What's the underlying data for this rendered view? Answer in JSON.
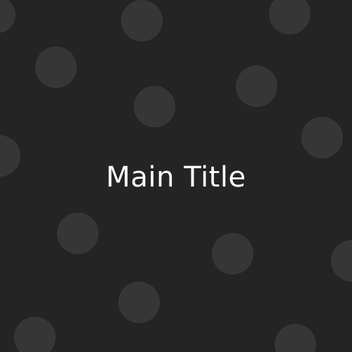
{
  "title": "Main Title",
  "colors": {
    "background": "#242424",
    "dot": "#363636",
    "title_text": "#ffffff"
  },
  "pattern": {
    "shape": "circle",
    "style": "polka-dot"
  }
}
